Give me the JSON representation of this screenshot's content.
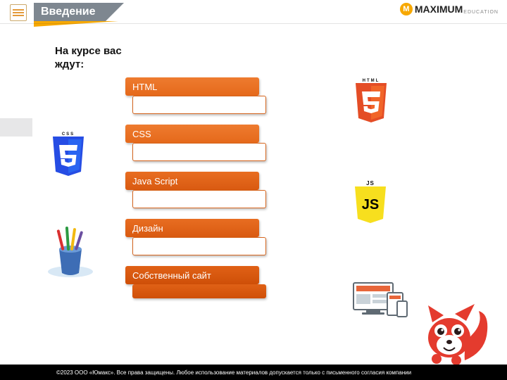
{
  "header": {
    "title": "Введение",
    "logo_brand": "MAXIMUM",
    "logo_sub": "EDUCATION"
  },
  "subtitle": "На курсе вас ждут:",
  "items": [
    {
      "label": "HTML"
    },
    {
      "label": "CSS"
    },
    {
      "label": "Java Script"
    },
    {
      "label": "Дизайн"
    },
    {
      "label": "Собственный сайт"
    }
  ],
  "icons": {
    "css3_label": "CSS",
    "html5_label": "HTML",
    "js_label": "JS"
  },
  "footer": "©2023 ООО «Юмакс». Все права защищены. Любое использование материалов допускается только с письменного согласия компании"
}
